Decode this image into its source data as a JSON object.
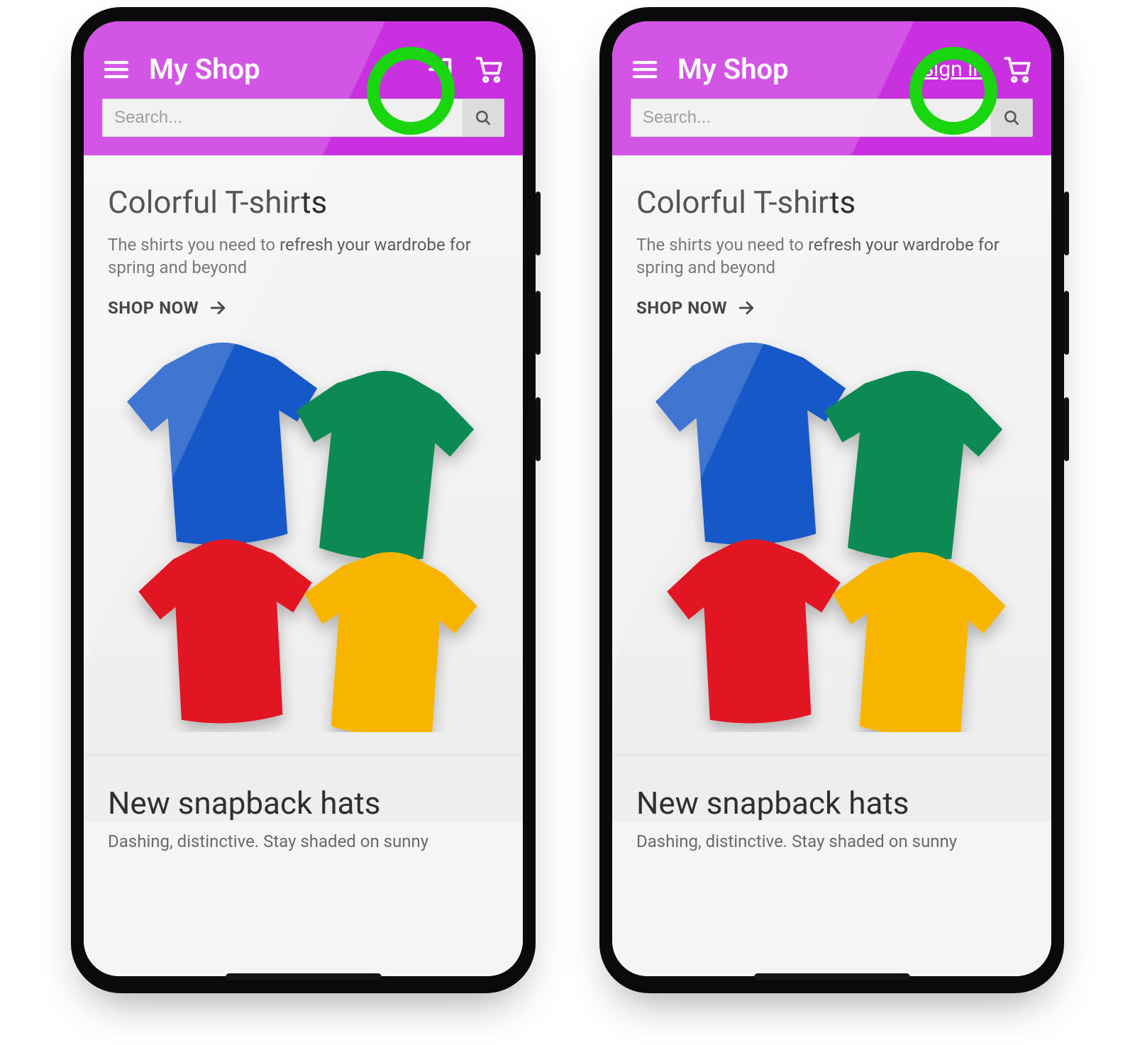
{
  "accent_color": "#c930e0",
  "highlight_color": "#19d60e",
  "header": {
    "title": "My Shop",
    "signin_label": "Sign in"
  },
  "search": {
    "placeholder": "Search..."
  },
  "cards": [
    {
      "title": "Colorful T-shirts",
      "subtitle": "The shirts you need to refresh your wardrobe for spring and beyond",
      "cta": "SHOP NOW"
    },
    {
      "title": "New snapback hats",
      "subtitle_truncated": "Dashing, distinctive. Stay shaded on sunny"
    }
  ],
  "icons": {
    "menu": "menu-icon",
    "login": "login-icon",
    "cart": "cart-icon",
    "search": "search-icon",
    "arrow_right": "arrow-right-icon"
  }
}
